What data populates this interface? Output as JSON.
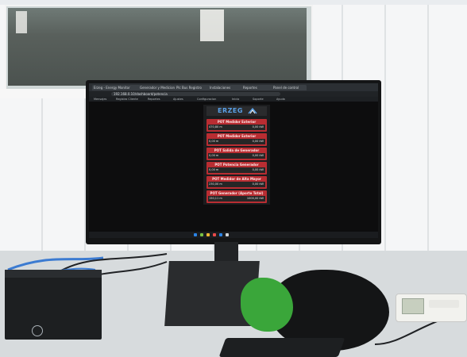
{
  "dashboard": {
    "logo": "ERZEG",
    "cards": [
      {
        "title": "POT Medidor Exterior",
        "left": "470,80 m",
        "right": "0,00 kW"
      },
      {
        "title": "POT Medidor Exterior",
        "left": "0,00 m",
        "right": "0,00 kW"
      },
      {
        "title": "POT Salida de Generador",
        "left": "0,00 m",
        "right": "0,00 kW"
      },
      {
        "title": "POT Potencia Generador",
        "left": "0,00 m",
        "right": "0,00 kW"
      },
      {
        "title": "POT Medidor de Alta Mayor",
        "left": "230,00 m",
        "right": "0,00 kW"
      },
      {
        "title": "POT Generador (Aporte Total)",
        "left": "150,11 m",
        "right": "1000,00 kW"
      }
    ]
  },
  "browser": {
    "tabs": [
      "Erzeg - Energy Monitor",
      "Generador y Medicion",
      "Plc Bus Registro",
      "Instalaciones",
      "Reportes",
      "Panel de control"
    ],
    "url": "192.168.0.10/dashboard/potencia",
    "bookmarks": [
      "Mensajes",
      "Registro Cliente",
      "Reportes",
      "Ajustes",
      "Configuracion",
      "Inicio",
      "Soporte",
      "Ayuda"
    ]
  },
  "colors": {
    "card_red": "#b92d32",
    "logo_blue": "#5aa0e6",
    "screen_bg": "#0d0d0e"
  },
  "icons": [
    "dell-logo-icon",
    "erzeg-logo-icon"
  ]
}
